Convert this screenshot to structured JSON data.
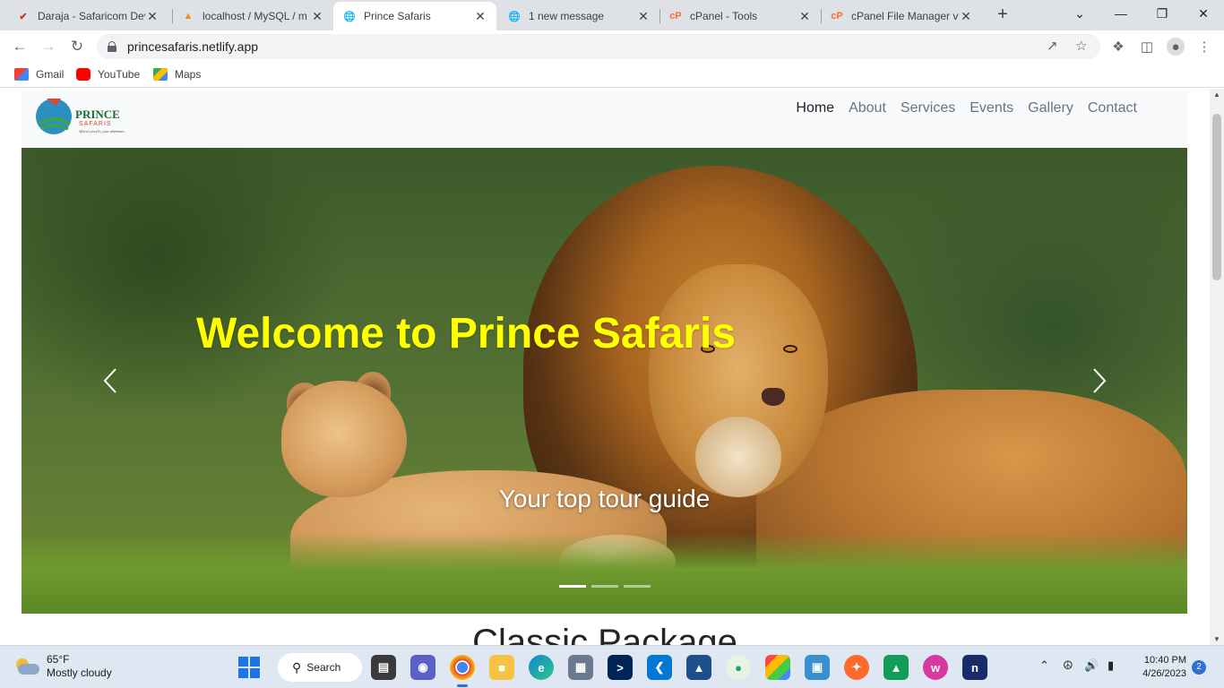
{
  "browser": {
    "tabs": [
      {
        "title": "Daraja - Safaricom Dev",
        "favicon": "safaricom-icon",
        "favicon_color": "#d93025"
      },
      {
        "title": "localhost / MySQL / m",
        "favicon": "phpmyadmin-icon",
        "favicon_color": "#f29111"
      },
      {
        "title": "Prince Safaris",
        "favicon": "globe-icon",
        "favicon_color": "#5f6368"
      },
      {
        "title": "1 new message",
        "favicon": "globe-icon",
        "favicon_color": "#5f6368"
      },
      {
        "title": "cPanel - Tools",
        "favicon": "cpanel-icon",
        "favicon_color": "#ff6c2c"
      },
      {
        "title": "cPanel File Manager v",
        "favicon": "cpanel-icon",
        "favicon_color": "#ff6c2c"
      }
    ],
    "active_tab": 2,
    "url": "princesafaris.netlify.app",
    "bookmarks": [
      {
        "label": "Gmail",
        "icon": "gmail-icon",
        "color": "#ea4335"
      },
      {
        "label": "YouTube",
        "icon": "youtube-icon",
        "color": "#ff0000"
      },
      {
        "label": "Maps",
        "icon": "maps-icon",
        "color": "#34a853"
      }
    ]
  },
  "site": {
    "logo_text": "PRINCE",
    "logo_sub": "SAFARIS",
    "logo_tagline": "Africa's jewel's, your adventure...",
    "nav": [
      "Home",
      "About",
      "Services",
      "Events",
      "Gallery",
      "Contact"
    ],
    "active_nav": "Home",
    "hero": {
      "title": "Welcome to Prince Safaris",
      "caption": "Your top tour guide",
      "title_color": "#ffff00"
    },
    "section_title": "Classic Package"
  },
  "taskbar": {
    "weather_temp": "65°F",
    "weather_desc": "Mostly cloudy",
    "search_label": "Search",
    "time": "10:40 PM",
    "date": "4/26/2023",
    "notifications": "2"
  }
}
